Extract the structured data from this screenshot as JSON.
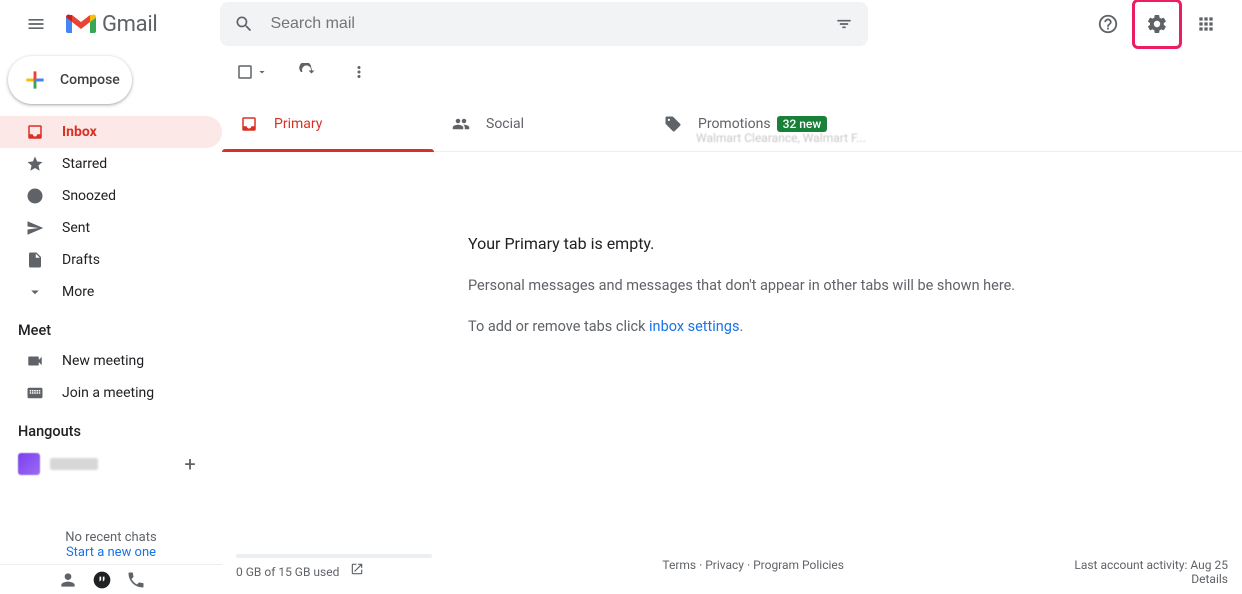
{
  "header": {
    "logo_text": "Gmail",
    "search_placeholder": "Search mail"
  },
  "sidebar": {
    "compose": "Compose",
    "items": [
      {
        "label": "Inbox"
      },
      {
        "label": "Starred"
      },
      {
        "label": "Snoozed"
      },
      {
        "label": "Sent"
      },
      {
        "label": "Drafts"
      },
      {
        "label": "More"
      }
    ],
    "meet_label": "Meet",
    "meet_items": [
      {
        "label": "New meeting"
      },
      {
        "label": "Join a meeting"
      }
    ],
    "hangouts_label": "Hangouts",
    "no_recent": "No recent chats",
    "start_new": "Start a new one"
  },
  "tabs": {
    "primary": "Primary",
    "social": "Social",
    "promotions": "Promotions",
    "promo_badge": "32 new",
    "promo_sub": "Walmart Clearance, Walmart F..."
  },
  "empty": {
    "title": "Your Primary tab is empty.",
    "line1": "Personal messages and messages that don't appear in other tabs will be shown here.",
    "line2_pre": "To add or remove tabs click ",
    "line2_link": "inbox settings",
    "line2_post": "."
  },
  "footer": {
    "storage": "0 GB of 15 GB used",
    "terms": "Terms",
    "privacy": "Privacy",
    "policies": "Program Policies",
    "activity": "Last account activity: Aug 25",
    "details": "Details"
  }
}
